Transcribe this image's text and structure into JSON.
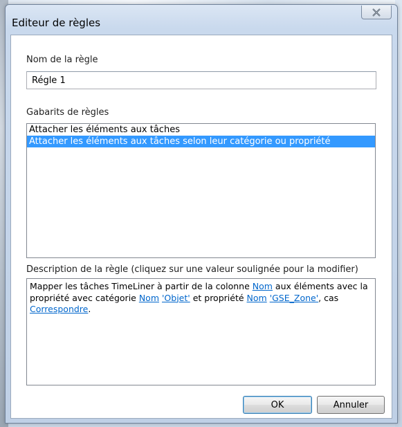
{
  "window": {
    "title": "Editeur de règles",
    "close_icon": "close-icon"
  },
  "rule_name": {
    "label": "Nom de la règle",
    "value": "Régle 1"
  },
  "templates": {
    "label": "Gabarits de règles",
    "items": [
      {
        "label": "Attacher les éléments aux tâches",
        "selected": false
      },
      {
        "label": "Attacher les éléments aux tâches selon leur catégorie ou propriété",
        "selected": true
      }
    ]
  },
  "description": {
    "label": "Description de la règle (cliquez sur une valeur soulignée pour la modifier)",
    "text_1": "Mapper les tâches TimeLiner à partir de la colonne ",
    "link_1": "Nom",
    "text_2": " aux éléments avec la propriété avec catégorie ",
    "link_2": "Nom",
    "link_3": "'Objet'",
    "text_3": " et propriété ",
    "link_4": "Nom",
    "link_5": "'GSE_Zone'",
    "text_4": ", cas ",
    "link_6": "Correspondre",
    "text_5": "."
  },
  "buttons": {
    "ok": "OK",
    "cancel": "Annuler"
  },
  "colors": {
    "selection": "#3399ff",
    "link": "#0066cc"
  }
}
